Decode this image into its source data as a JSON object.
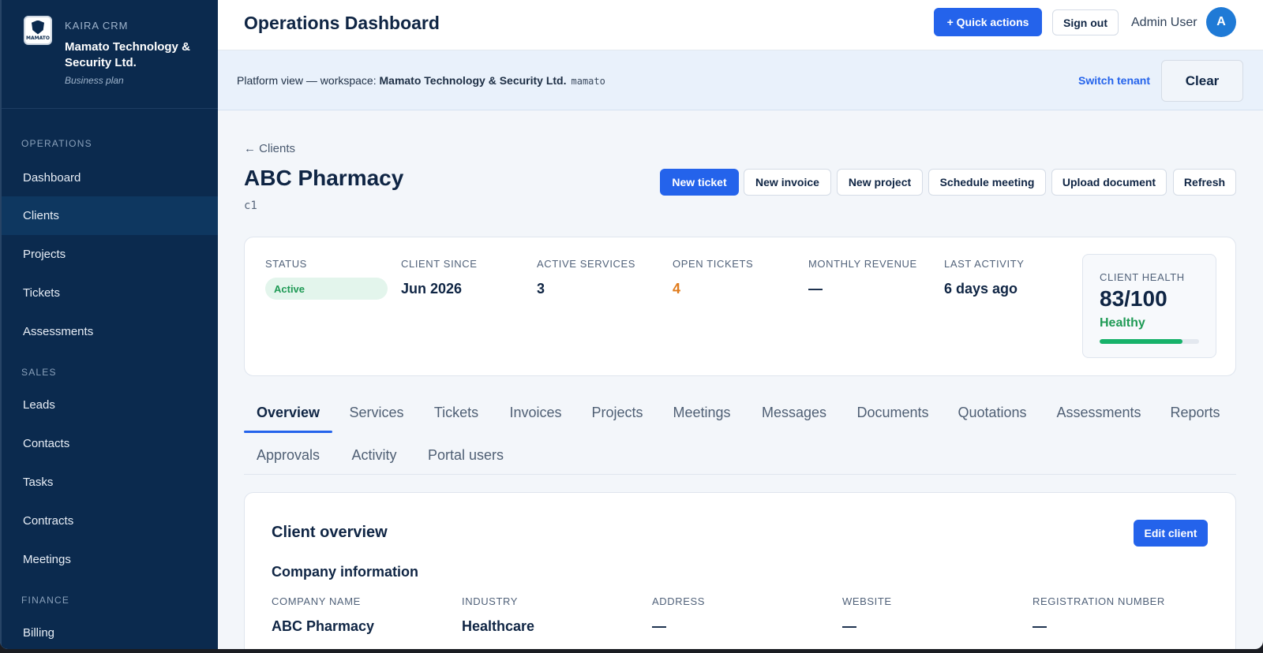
{
  "sidebar": {
    "kicker": "KAIRA CRM",
    "org_name": "Mamato Technology & Security Ltd.",
    "plan": "Business plan",
    "logo_text": "MAMATO",
    "sections": {
      "operations": "OPERATIONS",
      "sales": "SALES",
      "finance": "FINANCE"
    },
    "items": {
      "dashboard": "Dashboard",
      "clients": "Clients",
      "projects": "Projects",
      "tickets": "Tickets",
      "assessments": "Assessments",
      "leads": "Leads",
      "contacts": "Contacts",
      "tasks": "Tasks",
      "contracts": "Contracts",
      "meetings": "Meetings",
      "billing": "Billing"
    },
    "active_item": "Clients"
  },
  "topbar": {
    "title": "Operations Dashboard",
    "quick_actions": "+ Quick actions",
    "sign_out": "Sign out",
    "user_name": "Admin User",
    "avatar_initial": "A"
  },
  "tenant_bar": {
    "prefix": "Platform view — workspace: ",
    "workspace": "Mamato Technology & Security Ltd.",
    "slug": "mamato",
    "switch_label": "Switch tenant",
    "clear_label": "Clear"
  },
  "client": {
    "back_label": "← Clients",
    "name": "ABC Pharmacy",
    "code": "c1",
    "actions": {
      "new_ticket": "New ticket",
      "new_invoice": "New invoice",
      "new_project": "New project",
      "schedule_meeting": "Schedule meeting",
      "upload_document": "Upload document",
      "refresh": "Refresh"
    }
  },
  "summary": {
    "status_label": "STATUS",
    "status_value": "Active",
    "since_label": "CLIENT SINCE",
    "since_value": "Jun 2026",
    "services_label": "ACTIVE SERVICES",
    "services_value": "3",
    "tickets_label": "OPEN TICKETS",
    "tickets_value": "4",
    "revenue_label": "MONTHLY REVENUE",
    "revenue_value": "—",
    "activity_label": "LAST ACTIVITY",
    "activity_value": "6 days ago",
    "health_label": "CLIENT HEALTH",
    "health_score": "83/100",
    "health_state": "Healthy",
    "health_fraction": 0.83
  },
  "tabs": {
    "overview": "Overview",
    "services": "Services",
    "tickets": "Tickets",
    "invoices": "Invoices",
    "projects": "Projects",
    "meetings": "Meetings",
    "messages": "Messages",
    "documents": "Documents",
    "quotations": "Quotations",
    "assessments": "Assessments",
    "reports": "Reports",
    "approvals": "Approvals",
    "activity": "Activity",
    "portal_users": "Portal users",
    "active": "Overview"
  },
  "overview": {
    "title": "Client overview",
    "edit_label": "Edit client",
    "section_title": "Company information",
    "fields": {
      "company_name_label": "COMPANY NAME",
      "company_name_value": "ABC Pharmacy",
      "industry_label": "INDUSTRY",
      "industry_value": "Healthcare",
      "address_label": "ADDRESS",
      "address_value": "—",
      "website_label": "WEBSITE",
      "website_value": "—",
      "registration_label": "REGISTRATION NUMBER",
      "registration_value": "—"
    }
  },
  "colors": {
    "sidebar_bg": "#0b2a4e",
    "primary": "#2463eb",
    "success": "#1f9a55",
    "warning": "#e07b1c"
  }
}
